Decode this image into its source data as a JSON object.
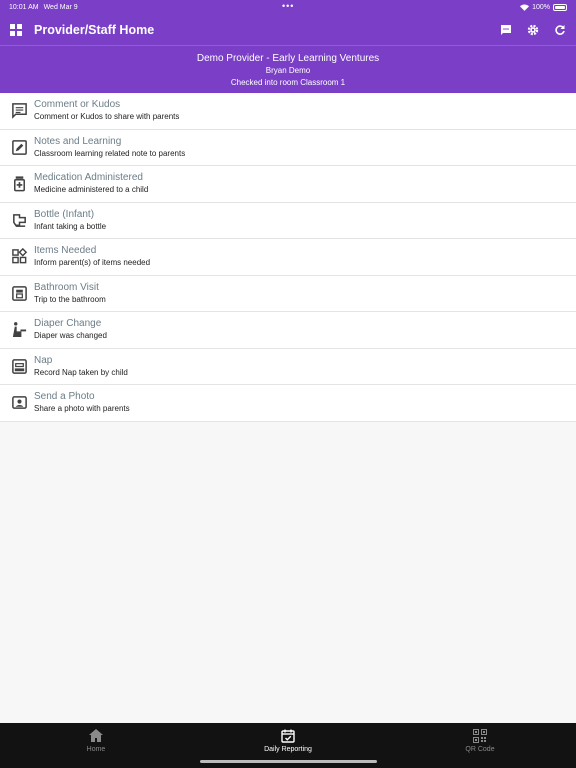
{
  "status": {
    "time": "10:01 AM",
    "date": "Wed Mar 9",
    "battery": "100%"
  },
  "header": {
    "title": "Provider/Staff Home"
  },
  "banner": {
    "line1": "Demo Provider - Early Learning Ventures",
    "line2": "Bryan Demo",
    "line3": "Checked into room Classroom 1"
  },
  "items": [
    {
      "title": "Comment or Kudos",
      "subtitle": "Comment or Kudos to share with parents",
      "icon": "comment-icon"
    },
    {
      "title": "Notes and Learning",
      "subtitle": "Classroom learning related note to parents",
      "icon": "edit-note-icon"
    },
    {
      "title": "Medication Administered",
      "subtitle": "Medicine administered to a child",
      "icon": "medication-icon"
    },
    {
      "title": "Bottle (Infant)",
      "subtitle": "Infant taking a bottle",
      "icon": "bottle-icon"
    },
    {
      "title": "Items Needed",
      "subtitle": "Inform parent(s) of items needed",
      "icon": "widgets-icon"
    },
    {
      "title": "Bathroom Visit",
      "subtitle": "Trip to the bathroom",
      "icon": "bathroom-icon"
    },
    {
      "title": "Diaper Change",
      "subtitle": "Diaper was changed",
      "icon": "diaper-change-icon"
    },
    {
      "title": "Nap",
      "subtitle": "Record Nap taken by child",
      "icon": "nap-icon"
    },
    {
      "title": "Send a Photo",
      "subtitle": "Share a photo with parents",
      "icon": "photo-icon"
    }
  ],
  "tabs": [
    {
      "label": "Home",
      "icon": "home-icon",
      "active": false
    },
    {
      "label": "Daily Reporting",
      "icon": "calendar-check-icon",
      "active": true
    },
    {
      "label": "QR Code",
      "icon": "qr-code-icon",
      "active": false
    }
  ],
  "colors": {
    "primary": "#7a3fc6",
    "tabbar": "#121212"
  }
}
